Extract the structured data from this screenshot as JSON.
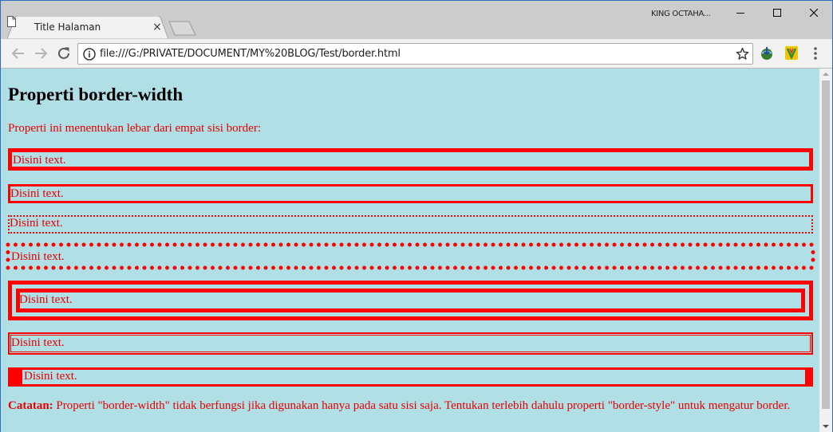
{
  "browser": {
    "tab_title": "Title Halaman",
    "tab_close": "×",
    "profile_name": "KING OCTAHA...",
    "url": "file:///G:/PRIVATE/DOCUMENT/MY%20BLOG/Test/border.html",
    "accent_color": "#2b6cc4"
  },
  "icons": [
    "page-icon",
    "back-arrow-icon",
    "forward-arrow-icon",
    "reload-icon",
    "info-icon",
    "star-icon",
    "extension-icon",
    "extension-v-icon",
    "menu-icon"
  ],
  "page": {
    "background_color": "#b0dfe5",
    "text_color": "#e60000",
    "heading": "Properti border-width",
    "intro": "Properti ini menentukan lebar dari empat sisi border:",
    "boxes": [
      {
        "text": "Disini text.",
        "style": "thick solid"
      },
      {
        "text": "Disini text.",
        "style": "medium solid"
      },
      {
        "text": "Disini text.",
        "style": "dotted"
      },
      {
        "text": "Disini text.",
        "style": "thick dotted"
      },
      {
        "text": "Disini text.",
        "style": "double thick"
      },
      {
        "text": "Disini text.",
        "style": "double thin"
      },
      {
        "text": "Disini text.",
        "style": "mixed widths"
      }
    ],
    "note_label": "Catatan:",
    "note_text": " Properti \"border-width\" tidak berfungsi jika digunakan hanya pada satu sisi saja. Tentukan terlebih dahulu properti \"border-style\" untuk mengatur border."
  }
}
